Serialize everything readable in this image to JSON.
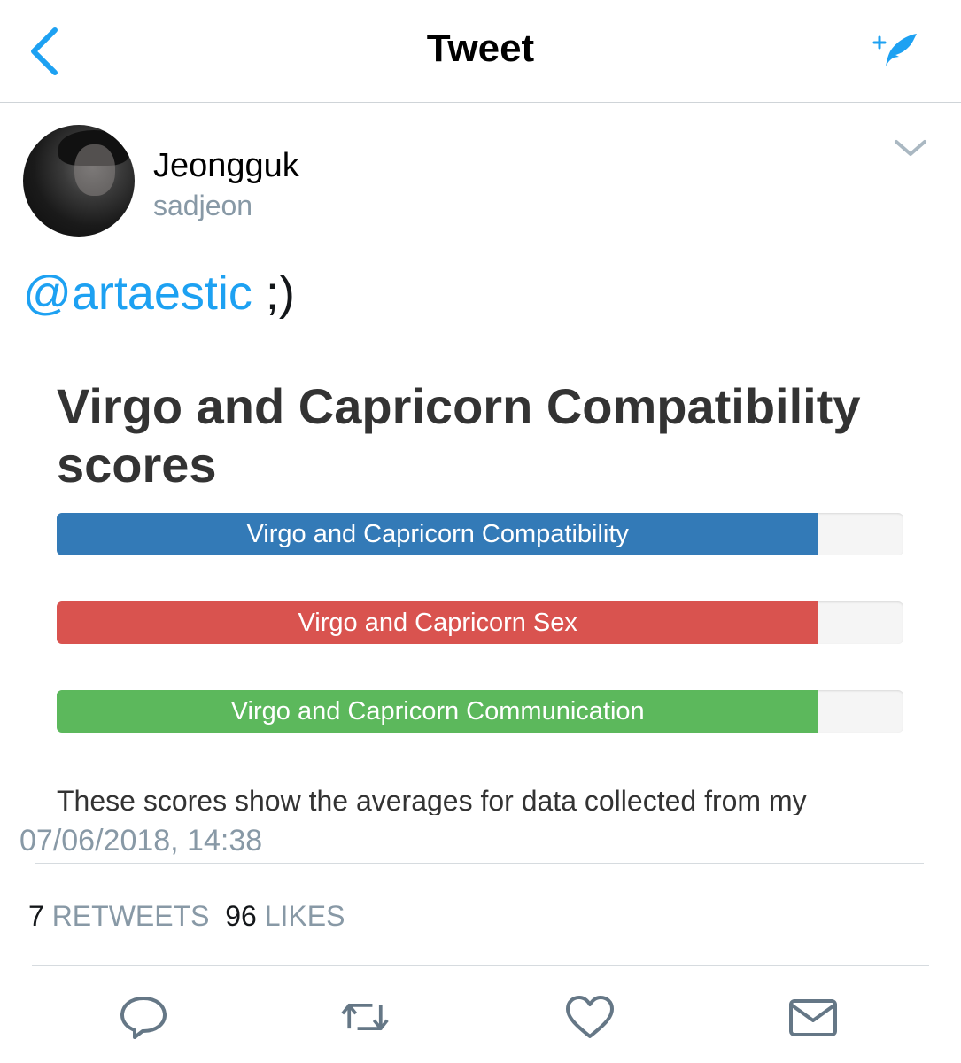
{
  "header": {
    "title": "Tweet",
    "back_icon": "back-chevron-icon",
    "compose_icon": "compose-tweet-icon"
  },
  "author": {
    "name": "Jeongguk",
    "handle": "sadjeon"
  },
  "tweet": {
    "mention": "@artaestic",
    "text": " ;)"
  },
  "card": {
    "title": "Virgo and Capricorn Compatibility scores",
    "bars": [
      {
        "label": "Virgo and Capricorn Compatibility",
        "fill_percent": 90,
        "color": "#337ab7"
      },
      {
        "label": "Virgo and Capricorn Sex",
        "fill_percent": 90,
        "color": "#d9534f"
      },
      {
        "label": "Virgo and Capricorn Communication",
        "fill_percent": 90,
        "color": "#5cb85c"
      }
    ],
    "description": "These scores show the averages for data collected from my"
  },
  "timestamp": "07/06/2018, 14:38",
  "stats": {
    "retweets_count": "7",
    "retweets_label": "RETWEETS",
    "likes_count": "96",
    "likes_label": "LIKES"
  },
  "actions": [
    "reply-icon",
    "retweet-icon",
    "like-icon",
    "direct-message-icon"
  ],
  "colors": {
    "accent": "#1da1f2",
    "muted": "#8899a6"
  }
}
